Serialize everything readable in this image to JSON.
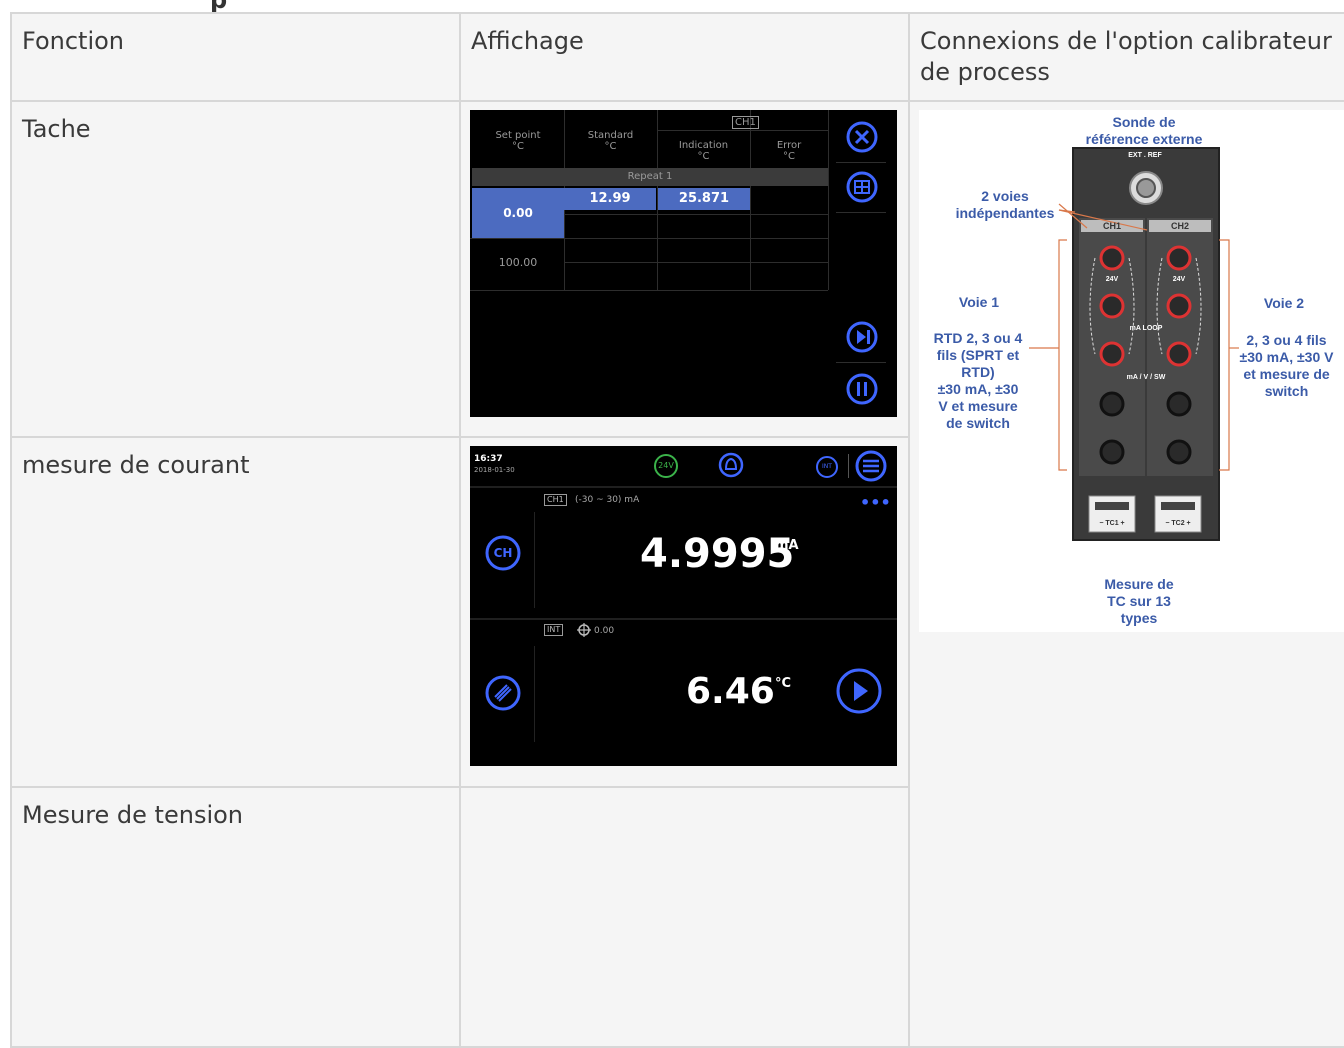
{
  "table": {
    "headers": [
      "Fonction",
      "Affichage",
      "Connexions de l'option calibrateur de process"
    ],
    "rows": [
      {
        "fonction": "Tache"
      },
      {
        "fonction": "mesure de courant"
      },
      {
        "fonction": "Mesure de tension"
      }
    ]
  },
  "screen1": {
    "col_setpoint": "Set point",
    "col_setpoint_unit": "°C",
    "col_standard": "Standard",
    "col_standard_unit": "°C",
    "channel": "CH1",
    "col_indication": "Indication",
    "col_indication_unit": "°C",
    "col_error": "Error",
    "col_error_unit": "°C",
    "repeat": "Repeat 1",
    "setpoint_1": "0.00",
    "standard_1": "12.99",
    "indication_1": "25.871",
    "setpoint_2": "100.00",
    "icons": [
      "close-icon",
      "table-icon",
      "skip-icon",
      "pause-icon"
    ]
  },
  "screen2": {
    "time": "16:37",
    "date": "2018-01-30",
    "badge_24v": "24V",
    "badge_int": "INT",
    "channel": "CH1",
    "range": "(-30 ~ 30) mA",
    "value_1": "4.9995",
    "unit_1": "mA",
    "channel_2": "INT",
    "offset": "0.00",
    "value_2": "6.46",
    "unit_2": "°C",
    "colors": {
      "accent": "#3f66ff",
      "badge_green": "#3bb34a"
    }
  },
  "diagram": {
    "sonde": "Sonde de\nréférence externe",
    "ext_ref": "EXT . REF",
    "voies": "2 voies\nindépendantes",
    "ch1": "CH1",
    "ch2": "CH2",
    "v24a": "24V",
    "v24b": "24V",
    "ma_loop": "mA LOOP",
    "ma_v_sw": "mA / V / SW",
    "voie1": "Voie 1",
    "voie1_desc": "RTD 2, 3 ou 4\nfils (SPRT et\nRTD)\n±30 mA, ±30\nV et mesure\nde switch",
    "voie2": "Voie 2",
    "voie2_desc": "2, 3 ou 4 fils\n±30 mA, ±30 V\net mesure de\nswitch",
    "tc1": "− TC1 +",
    "tc2": "− TC2 +",
    "mesure_tc": "Mesure de\nTC sur 13\ntypes"
  }
}
